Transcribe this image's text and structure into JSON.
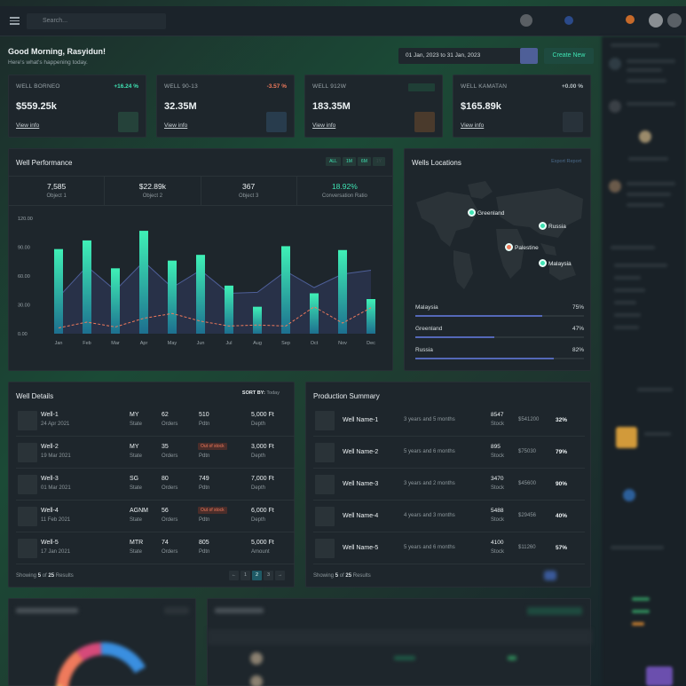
{
  "header": {
    "search_placeholder": "Search..."
  },
  "greeting": {
    "title": "Good Morning, Rasyidun!",
    "subtitle": "Here's what's happening today."
  },
  "date_range": "01 Jan, 2023 to 31 Jan, 2023",
  "create_label": "Create New",
  "kpis": [
    {
      "label": "WELL BORNEO",
      "pct": "+16.24 %",
      "pct_color": "#3fe3b3",
      "value": "$559.25k",
      "link": "View info",
      "tile": "#25423a"
    },
    {
      "label": "WELL 90-13",
      "pct": "-3.57 %",
      "pct_color": "#ef7a5c",
      "value": "32.35M",
      "link": "View info",
      "tile": "#283c4d"
    },
    {
      "label": "WELL 912W",
      "pct": "",
      "pct_color": "#3fe3b3",
      "value": "183.35M",
      "link": "View info",
      "tile": "#4a3a2c"
    },
    {
      "label": "WELL KAMATAN",
      "pct": "+0.00 %",
      "pct_color": "#b8c1c5",
      "value": "$165.89k",
      "link": "View info",
      "tile": "#28323a"
    }
  ],
  "performance": {
    "title": "Well Performance",
    "filters": [
      "ALL",
      "1M",
      "6M",
      "1Y"
    ],
    "stats": [
      {
        "value": "7,585",
        "label": "Object 1"
      },
      {
        "value": "$22.89k",
        "label": "Object 2"
      },
      {
        "value": "367",
        "label": "Object 3"
      },
      {
        "value": "18.92%",
        "label": "Conversation Ratio"
      }
    ]
  },
  "chart_data": {
    "type": "bar",
    "categories": [
      "Jan",
      "Feb",
      "Mar",
      "Apr",
      "May",
      "Jun",
      "Jul",
      "Aug",
      "Sep",
      "Oct",
      "Nov",
      "Dec"
    ],
    "ylim": [
      0,
      120
    ],
    "yticks": [
      "120.00",
      "90.00",
      "60.00",
      "30.00",
      "0.00"
    ],
    "series": [
      {
        "type": "bar",
        "values": [
          88,
          97,
          68,
          107,
          76,
          82,
          50,
          28,
          91,
          42,
          87,
          36
        ]
      },
      {
        "type": "area",
        "values": [
          38,
          70,
          45,
          75,
          48,
          66,
          42,
          43,
          65,
          48,
          62,
          66
        ]
      },
      {
        "type": "line",
        "values": [
          6,
          12,
          7,
          16,
          21,
          13,
          8,
          9,
          8,
          28,
          11,
          27
        ]
      }
    ]
  },
  "locations": {
    "title": "Wells Locations",
    "action": "Export Report",
    "pins": [
      {
        "name": "Greenland",
        "color": "#3fe3b3"
      },
      {
        "name": "Russia",
        "color": "#3fe3b3"
      },
      {
        "name": "Palestine",
        "color": "#ef7a5c"
      },
      {
        "name": "Malaysia",
        "color": "#3fe3b3"
      }
    ],
    "bars": [
      {
        "name": "Malaysia",
        "pct": "75%",
        "value": 0.75
      },
      {
        "name": "Greenland",
        "pct": "47%",
        "value": 0.47
      },
      {
        "name": "Russia",
        "pct": "82%",
        "value": 0.82
      }
    ]
  },
  "well_details": {
    "title": "Well Details",
    "sort_label": "SORT BY:",
    "sort_value": "Today",
    "rows": [
      {
        "name": "Well-1",
        "date": "24 Apr 2021",
        "code": "MY",
        "code_lbl": "State",
        "orders": "62",
        "orders_lbl": "Orders",
        "pdtn": "510",
        "pdtn_lbl": "Pdtn",
        "depth": "5,000 Ft",
        "depth_lbl": "Depth"
      },
      {
        "name": "Well-2",
        "date": "19 Mar 2021",
        "code": "MY",
        "code_lbl": "State",
        "orders": "35",
        "orders_lbl": "Orders",
        "pdtn": "Out of stock",
        "pdtn_lbl": "Pdtn",
        "depth": "3,000 Ft",
        "depth_lbl": "Depth"
      },
      {
        "name": "Well-3",
        "date": "01 Mar 2021",
        "code": "SG",
        "code_lbl": "State",
        "orders": "80",
        "orders_lbl": "Orders",
        "pdtn": "749",
        "pdtn_lbl": "Pdtn",
        "depth": "7,000 Ft",
        "depth_lbl": "Depth"
      },
      {
        "name": "Well-4",
        "date": "11 Feb 2021",
        "code": "AGNM",
        "code_lbl": "State",
        "orders": "56",
        "orders_lbl": "Orders",
        "pdtn": "Out of stock",
        "pdtn_lbl": "Pdtn",
        "depth": "6,000 Ft",
        "depth_lbl": "Depth"
      },
      {
        "name": "Well-5",
        "date": "17 Jan 2021",
        "code": "MTR",
        "code_lbl": "State",
        "orders": "74",
        "orders_lbl": "Orders",
        "pdtn": "805",
        "pdtn_lbl": "Pdtn",
        "depth": "5,000 Ft",
        "depth_lbl": "Amount"
      }
    ],
    "footer": {
      "pre": "Showing ",
      "shown": "5",
      "mid": " of ",
      "total": "25",
      "post": " Results"
    },
    "pages": [
      "←",
      "1",
      "2",
      "3",
      "→"
    ]
  },
  "production": {
    "title": "Production Summary",
    "rows": [
      {
        "name": "Well Name-1",
        "duration": "3 years and 5 months",
        "stock": "8547",
        "stock_lbl": "Stock",
        "price": "$541200",
        "pct": "32%"
      },
      {
        "name": "Well Name-2",
        "duration": "5 years and 6 months",
        "stock": "895",
        "stock_lbl": "Stock",
        "price": "$75030",
        "pct": "79%"
      },
      {
        "name": "Well Name-3",
        "duration": "3 years and 2 months",
        "stock": "3470",
        "stock_lbl": "Stock",
        "price": "$45600",
        "pct": "90%"
      },
      {
        "name": "Well Name-4",
        "duration": "4 years and 3 months",
        "stock": "5488",
        "stock_lbl": "Stock",
        "price": "$29456",
        "pct": "40%"
      },
      {
        "name": "Well Name-5",
        "duration": "5 years and 6 months",
        "stock": "4100",
        "stock_lbl": "Stock",
        "price": "$11260",
        "pct": "57%"
      }
    ],
    "footer": {
      "pre": "Showing ",
      "shown": "5",
      "mid": " of ",
      "total": "25",
      "post": " Results"
    }
  },
  "colors": {
    "accent": "#3fe3b3",
    "negative": "#ef7a5c",
    "bar_fill": "#5468b8",
    "panel": "#1e262c"
  }
}
